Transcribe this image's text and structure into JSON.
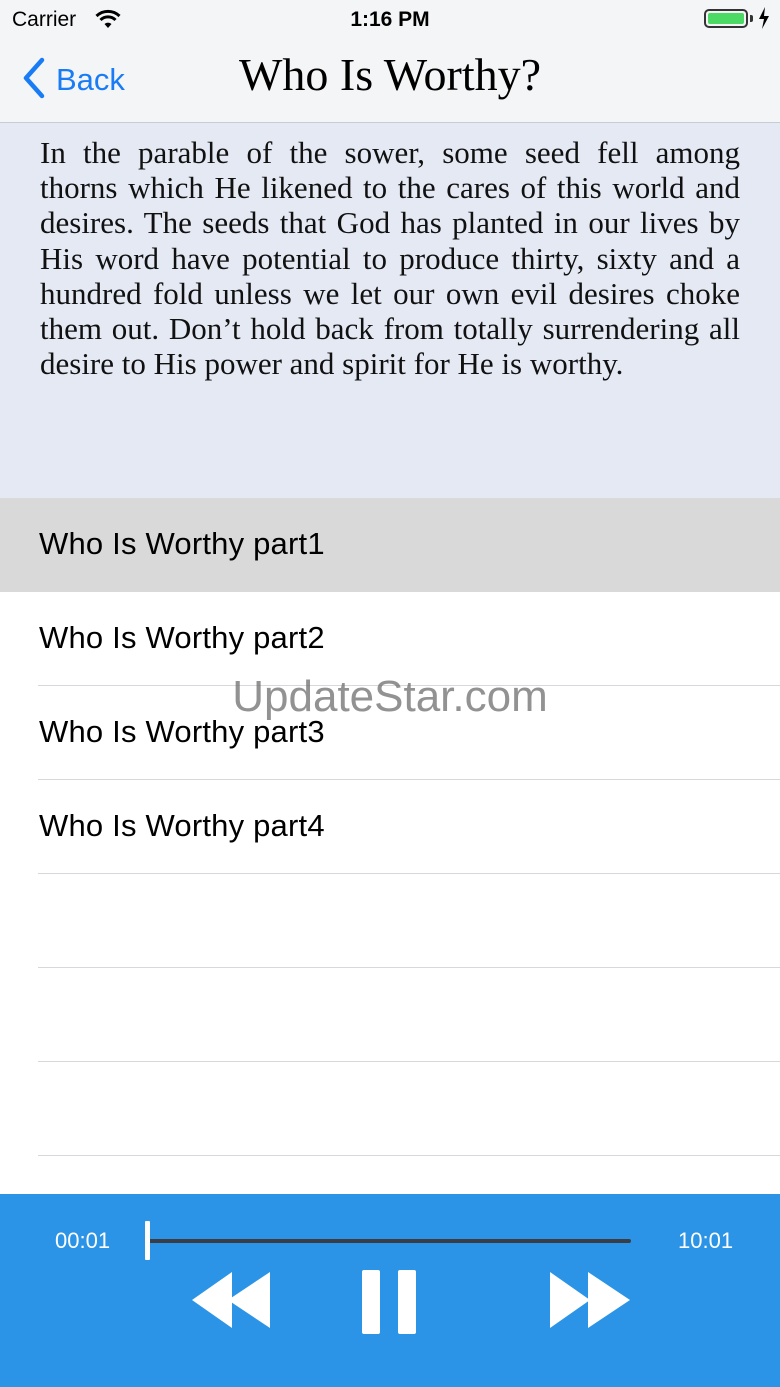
{
  "status_bar": {
    "carrier": "Carrier",
    "time": "1:16 PM",
    "battery_color": "#4cd964"
  },
  "nav": {
    "back_label": "Back",
    "title": "Who Is Worthy?",
    "accent_color": "#1a7cf5"
  },
  "description": "In the parable of the sower, some seed fell among thorns which He likened to the cares of this world and desires. The seeds that God has planted in our lives by His word have potential to produce thirty, sixty and a hundred fold unless we let our own evil desires choke them out. Don’t hold back from totally surrendering all desire to His power and spirit for He is worthy.",
  "tracks": [
    {
      "label": "Who Is Worthy  part1",
      "selected": true
    },
    {
      "label": "Who Is Worthy  part2",
      "selected": false
    },
    {
      "label": "Who Is Worthy  part3",
      "selected": false
    },
    {
      "label": "Who Is Worthy  part4",
      "selected": false
    }
  ],
  "watermark": "UpdateStar.com",
  "player": {
    "current_time": "00:01",
    "total_time": "10:01",
    "progress_fraction": 0.0,
    "background_color": "#2b94e6",
    "icons": [
      "rewind-icon",
      "pause-icon",
      "fast-forward-icon"
    ]
  }
}
